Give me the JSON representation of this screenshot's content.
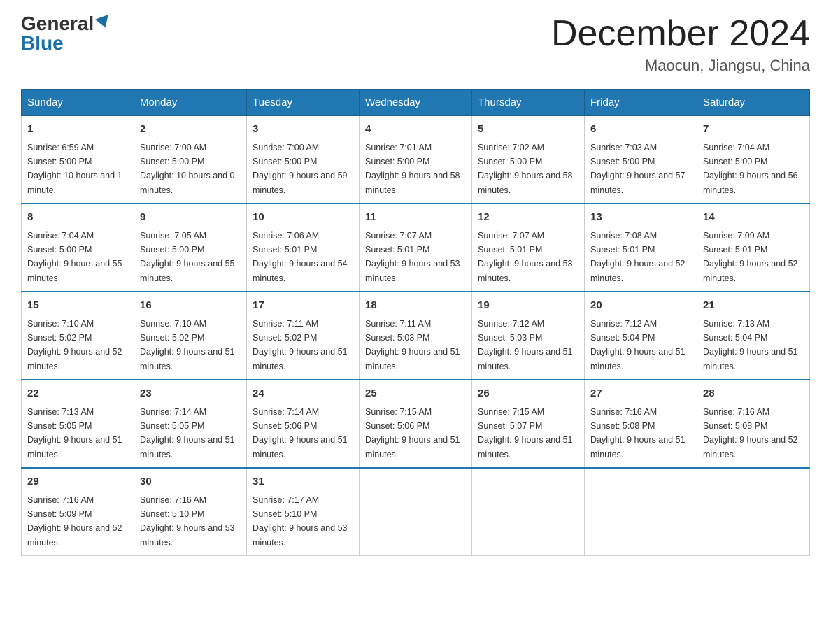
{
  "header": {
    "logo_general": "General",
    "logo_blue": "Blue",
    "month_title": "December 2024",
    "location": "Maocun, Jiangsu, China"
  },
  "days_of_week": [
    "Sunday",
    "Monday",
    "Tuesday",
    "Wednesday",
    "Thursday",
    "Friday",
    "Saturday"
  ],
  "weeks": [
    [
      {
        "day": "1",
        "sunrise": "6:59 AM",
        "sunset": "5:00 PM",
        "daylight": "10 hours and 1 minute."
      },
      {
        "day": "2",
        "sunrise": "7:00 AM",
        "sunset": "5:00 PM",
        "daylight": "10 hours and 0 minutes."
      },
      {
        "day": "3",
        "sunrise": "7:00 AM",
        "sunset": "5:00 PM",
        "daylight": "9 hours and 59 minutes."
      },
      {
        "day": "4",
        "sunrise": "7:01 AM",
        "sunset": "5:00 PM",
        "daylight": "9 hours and 58 minutes."
      },
      {
        "day": "5",
        "sunrise": "7:02 AM",
        "sunset": "5:00 PM",
        "daylight": "9 hours and 58 minutes."
      },
      {
        "day": "6",
        "sunrise": "7:03 AM",
        "sunset": "5:00 PM",
        "daylight": "9 hours and 57 minutes."
      },
      {
        "day": "7",
        "sunrise": "7:04 AM",
        "sunset": "5:00 PM",
        "daylight": "9 hours and 56 minutes."
      }
    ],
    [
      {
        "day": "8",
        "sunrise": "7:04 AM",
        "sunset": "5:00 PM",
        "daylight": "9 hours and 55 minutes."
      },
      {
        "day": "9",
        "sunrise": "7:05 AM",
        "sunset": "5:00 PM",
        "daylight": "9 hours and 55 minutes."
      },
      {
        "day": "10",
        "sunrise": "7:06 AM",
        "sunset": "5:01 PM",
        "daylight": "9 hours and 54 minutes."
      },
      {
        "day": "11",
        "sunrise": "7:07 AM",
        "sunset": "5:01 PM",
        "daylight": "9 hours and 53 minutes."
      },
      {
        "day": "12",
        "sunrise": "7:07 AM",
        "sunset": "5:01 PM",
        "daylight": "9 hours and 53 minutes."
      },
      {
        "day": "13",
        "sunrise": "7:08 AM",
        "sunset": "5:01 PM",
        "daylight": "9 hours and 52 minutes."
      },
      {
        "day": "14",
        "sunrise": "7:09 AM",
        "sunset": "5:01 PM",
        "daylight": "9 hours and 52 minutes."
      }
    ],
    [
      {
        "day": "15",
        "sunrise": "7:10 AM",
        "sunset": "5:02 PM",
        "daylight": "9 hours and 52 minutes."
      },
      {
        "day": "16",
        "sunrise": "7:10 AM",
        "sunset": "5:02 PM",
        "daylight": "9 hours and 51 minutes."
      },
      {
        "day": "17",
        "sunrise": "7:11 AM",
        "sunset": "5:02 PM",
        "daylight": "9 hours and 51 minutes."
      },
      {
        "day": "18",
        "sunrise": "7:11 AM",
        "sunset": "5:03 PM",
        "daylight": "9 hours and 51 minutes."
      },
      {
        "day": "19",
        "sunrise": "7:12 AM",
        "sunset": "5:03 PM",
        "daylight": "9 hours and 51 minutes."
      },
      {
        "day": "20",
        "sunrise": "7:12 AM",
        "sunset": "5:04 PM",
        "daylight": "9 hours and 51 minutes."
      },
      {
        "day": "21",
        "sunrise": "7:13 AM",
        "sunset": "5:04 PM",
        "daylight": "9 hours and 51 minutes."
      }
    ],
    [
      {
        "day": "22",
        "sunrise": "7:13 AM",
        "sunset": "5:05 PM",
        "daylight": "9 hours and 51 minutes."
      },
      {
        "day": "23",
        "sunrise": "7:14 AM",
        "sunset": "5:05 PM",
        "daylight": "9 hours and 51 minutes."
      },
      {
        "day": "24",
        "sunrise": "7:14 AM",
        "sunset": "5:06 PM",
        "daylight": "9 hours and 51 minutes."
      },
      {
        "day": "25",
        "sunrise": "7:15 AM",
        "sunset": "5:06 PM",
        "daylight": "9 hours and 51 minutes."
      },
      {
        "day": "26",
        "sunrise": "7:15 AM",
        "sunset": "5:07 PM",
        "daylight": "9 hours and 51 minutes."
      },
      {
        "day": "27",
        "sunrise": "7:16 AM",
        "sunset": "5:08 PM",
        "daylight": "9 hours and 51 minutes."
      },
      {
        "day": "28",
        "sunrise": "7:16 AM",
        "sunset": "5:08 PM",
        "daylight": "9 hours and 52 minutes."
      }
    ],
    [
      {
        "day": "29",
        "sunrise": "7:16 AM",
        "sunset": "5:09 PM",
        "daylight": "9 hours and 52 minutes."
      },
      {
        "day": "30",
        "sunrise": "7:16 AM",
        "sunset": "5:10 PM",
        "daylight": "9 hours and 53 minutes."
      },
      {
        "day": "31",
        "sunrise": "7:17 AM",
        "sunset": "5:10 PM",
        "daylight": "9 hours and 53 minutes."
      },
      null,
      null,
      null,
      null
    ]
  ]
}
